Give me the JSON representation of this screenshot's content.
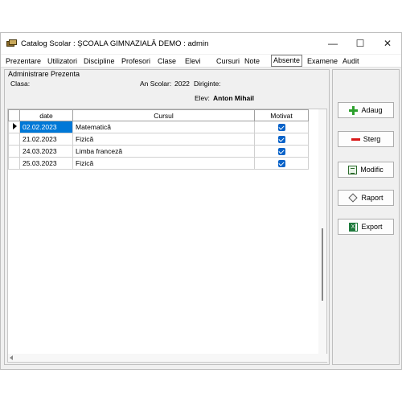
{
  "window": {
    "title": "Catalog Scolar : ŞCOALA GIMNAZIALĂ DEMO : admin",
    "minimize": "—",
    "maximize": "☐",
    "close": "✕"
  },
  "menu": [
    "Prezentare",
    "Utilizatori",
    "Discipline",
    "Profesori",
    "Clase",
    "Elevi",
    "Cursuri",
    "Note",
    "Absente",
    "Examene",
    "Audit"
  ],
  "active_menu": "Absente",
  "panel": {
    "header": "Administrare Prezenta",
    "clasa_label": "Clasa:",
    "an_scolar_label": "An Scolar:",
    "an_scolar_value": "2022",
    "diriginte_label": "Diriginte:",
    "elev_label": "Elev:",
    "elev_value": "Anton Mihail"
  },
  "table": {
    "columns": [
      "date",
      "Cursul",
      "Motivat"
    ],
    "rows": [
      {
        "date": "02.02.2023",
        "cursul": "Matematică",
        "motivat": true
      },
      {
        "date": "21.02.2023",
        "cursul": "Fizică",
        "motivat": true
      },
      {
        "date": "24.03.2023",
        "cursul": "Limba franceză",
        "motivat": true
      },
      {
        "date": "25.03.2023",
        "cursul": "Fizică",
        "motivat": true
      }
    ]
  },
  "actions": {
    "add": "Adaug",
    "delete": "Sterg",
    "modify": "Modific",
    "report": "Raport",
    "export": "Export"
  },
  "colors": {
    "selection": "#0078d7",
    "checkbox": "#0a63c9",
    "add_icon": "#2da02d",
    "delete_icon": "#d81818"
  }
}
